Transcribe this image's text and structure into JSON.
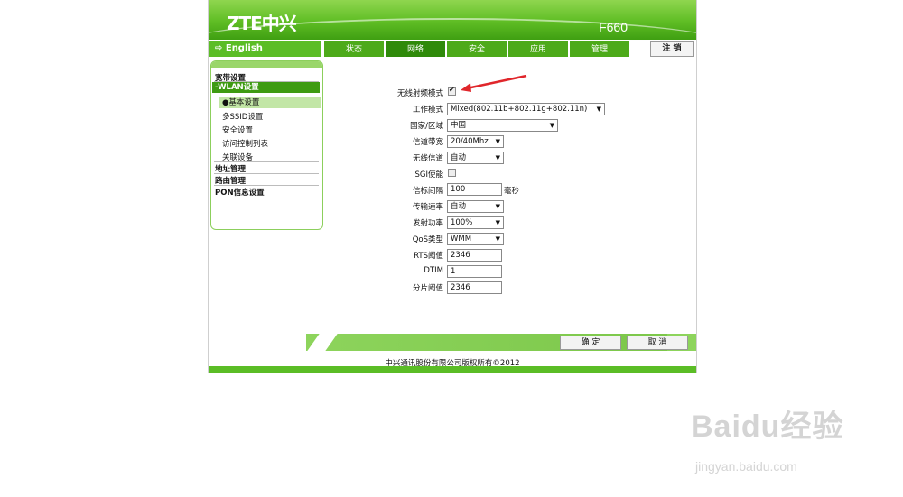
{
  "header": {
    "logo": "ZTE中兴",
    "model": "F660"
  },
  "nav": {
    "language": "⇨ English",
    "tabs": [
      "状态",
      "网络",
      "安全",
      "应用",
      "管理"
    ],
    "active_tab": "网络",
    "logout": "注 销"
  },
  "sidebar": {
    "items": [
      "宽带设置",
      "-WLAN设置",
      "地址管理",
      "路由管理",
      "PON信息设置"
    ],
    "sub_items": [
      "●基本设置",
      "多SSID设置",
      "安全设置",
      "访问控制列表",
      "关联设备"
    ]
  },
  "form": {
    "radio_enable_label": "无线射频模式",
    "radio_enable_checked": true,
    "mode_label": "工作模式",
    "mode_value": "Mixed(802.11b+802.11g+802.11n)",
    "country_label": "国家/区域",
    "country_value": "中国",
    "bandwidth_label": "信道带宽",
    "bandwidth_value": "20/40Mhz",
    "channel_label": "无线信道",
    "channel_value": "自动",
    "sgi_label": "SGI使能",
    "sgi_checked": false,
    "beacon_label": "信标间隔",
    "beacon_value": "100",
    "beacon_unit": "毫秒",
    "rate_label": "传输速率",
    "rate_value": "自动",
    "power_label": "发射功率",
    "power_value": "100%",
    "qos_label": "QoS类型",
    "qos_value": "WMM",
    "rts_label": "RTS阈值",
    "rts_value": "2346",
    "dtim_label": "DTIM",
    "dtim_value": "1",
    "frag_label": "分片阈值",
    "frag_value": "2346"
  },
  "buttons": {
    "confirm": "确 定",
    "cancel": "取 消"
  },
  "footer": {
    "copyright": "中兴通讯股份有限公司版权所有©2012"
  },
  "watermark": {
    "brand": "Baidu经验",
    "url": "jingyan.baidu.com"
  },
  "colors": {
    "brand_green": "#5bbd26",
    "dark_green": "#2f8a0a",
    "annotation_red": "#e0262b"
  }
}
